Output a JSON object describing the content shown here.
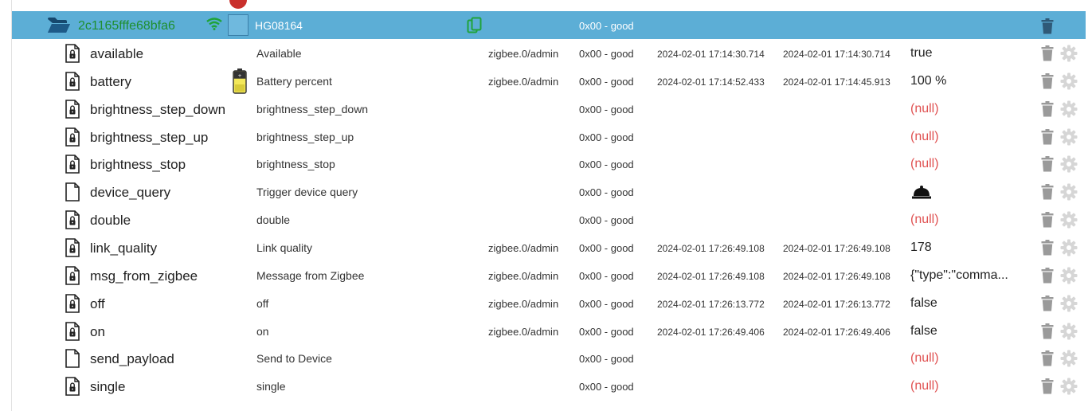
{
  "header": {
    "device_id": "2c1165fffe68bfa6",
    "model": "HG08164",
    "status": "0x00 - good",
    "icons": [
      "folder-open-icon",
      "wifi-icon",
      "copy-icon",
      "trash-icon"
    ]
  },
  "colors": {
    "header_bg": "#5caed6",
    "device_id": "#1e8f2f",
    "null_value": "#e05252",
    "icon_gray": "#9a9a9a"
  },
  "rows": [
    {
      "name": "available",
      "icon": "file-lock-icon",
      "description": "Available",
      "source": "zigbee.0/admin",
      "status": "0x00 - good",
      "timestamp": "2024-02-01 17:14:30.714",
      "last_change": "2024-02-01 17:14:30.714",
      "value": "true",
      "is_null": false
    },
    {
      "name": "battery",
      "icon": "file-lock-icon",
      "device_icon": "battery-device-icon",
      "description": "Battery percent",
      "source": "zigbee.0/admin",
      "status": "0x00 - good",
      "timestamp": "2024-02-01 17:14:52.433",
      "last_change": "2024-02-01 17:14:45.913",
      "value": "100 %",
      "is_null": false
    },
    {
      "name": "brightness_step_down",
      "icon": "file-lock-icon",
      "description": "brightness_step_down",
      "source": "",
      "status": "0x00 - good",
      "timestamp": "",
      "last_change": "",
      "value": "(null)",
      "is_null": true
    },
    {
      "name": "brightness_step_up",
      "icon": "file-lock-icon",
      "description": "brightness_step_up",
      "source": "",
      "status": "0x00 - good",
      "timestamp": "",
      "last_change": "",
      "value": "(null)",
      "is_null": true
    },
    {
      "name": "brightness_stop",
      "icon": "file-lock-icon",
      "description": "brightness_stop",
      "source": "",
      "status": "0x00 - good",
      "timestamp": "",
      "last_change": "",
      "value": "(null)",
      "is_null": true
    },
    {
      "name": "device_query",
      "icon": "file-icon",
      "description": "Trigger device query",
      "source": "",
      "status": "0x00 - good",
      "timestamp": "",
      "last_change": "",
      "value": "",
      "is_null": false,
      "value_icon": "bell-icon"
    },
    {
      "name": "double",
      "icon": "file-lock-icon",
      "description": "double",
      "source": "",
      "status": "0x00 - good",
      "timestamp": "",
      "last_change": "",
      "value": "(null)",
      "is_null": true
    },
    {
      "name": "link_quality",
      "icon": "file-lock-icon",
      "description": "Link quality",
      "source": "zigbee.0/admin",
      "status": "0x00 - good",
      "timestamp": "2024-02-01 17:26:49.108",
      "last_change": "2024-02-01 17:26:49.108",
      "value": "178",
      "is_null": false
    },
    {
      "name": "msg_from_zigbee",
      "icon": "file-lock-icon",
      "description": "Message from Zigbee",
      "source": "zigbee.0/admin",
      "status": "0x00 - good",
      "timestamp": "2024-02-01 17:26:49.108",
      "last_change": "2024-02-01 17:26:49.108",
      "value": "{\"type\":\"comma...",
      "is_null": false
    },
    {
      "name": "off",
      "icon": "file-lock-icon",
      "description": "off",
      "source": "zigbee.0/admin",
      "status": "0x00 - good",
      "timestamp": "2024-02-01 17:26:13.772",
      "last_change": "2024-02-01 17:26:13.772",
      "value": "false",
      "is_null": false
    },
    {
      "name": "on",
      "icon": "file-lock-icon",
      "description": "on",
      "source": "zigbee.0/admin",
      "status": "0x00 - good",
      "timestamp": "2024-02-01 17:26:49.406",
      "last_change": "2024-02-01 17:26:49.406",
      "value": "false",
      "is_null": false
    },
    {
      "name": "send_payload",
      "icon": "file-icon",
      "description": "Send to Device",
      "source": "",
      "status": "0x00 - good",
      "timestamp": "",
      "last_change": "",
      "value": "(null)",
      "is_null": true
    },
    {
      "name": "single",
      "icon": "file-lock-icon",
      "description": "single",
      "source": "",
      "status": "0x00 - good",
      "timestamp": "",
      "last_change": "",
      "value": "(null)",
      "is_null": true
    }
  ]
}
